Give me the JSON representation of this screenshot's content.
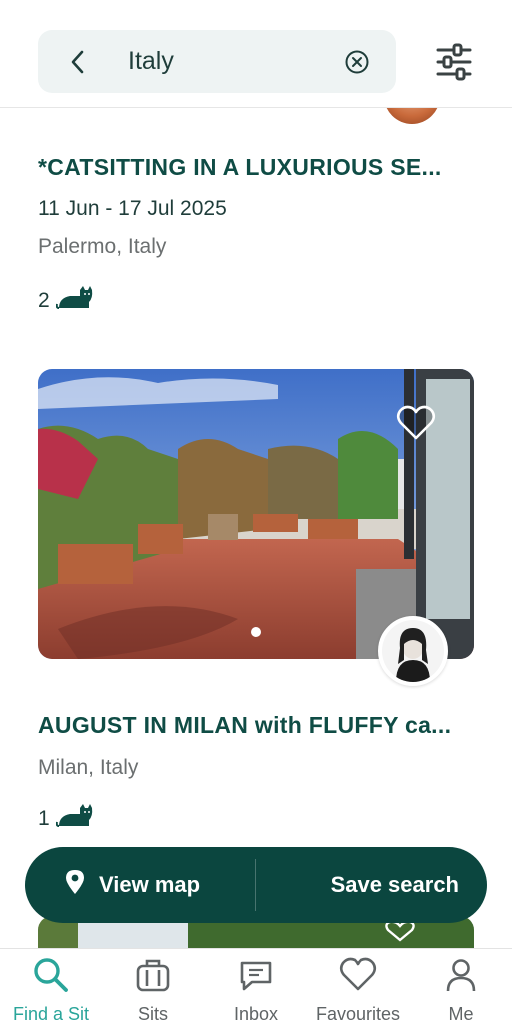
{
  "search": {
    "query": "Italy"
  },
  "listings": [
    {
      "title": "*CATSITTING IN A LUXURIOUS SE...",
      "dates": "11 Jun - 17 Jul 2025",
      "location": "Palermo, Italy",
      "pet_count": "2",
      "pet_icon": "cat-icon"
    },
    {
      "title": "AUGUST IN MILAN with FLUFFY ca...",
      "location": "Milan, Italy",
      "pet_count": "1",
      "pet_icon": "cat-icon"
    }
  ],
  "actions": {
    "view_map": "View map",
    "save_search": "Save search"
  },
  "nav": [
    {
      "label": "Find a Sit",
      "icon": "search-icon",
      "active": true
    },
    {
      "label": "Sits",
      "icon": "suitcase-icon"
    },
    {
      "label": "Inbox",
      "icon": "chat-icon"
    },
    {
      "label": "Favourites",
      "icon": "heart-icon"
    },
    {
      "label": "Me",
      "icon": "person-icon"
    }
  ],
  "colors": {
    "brand": "#0b463f",
    "accent": "#2aa59a",
    "text_primary": "#0f4c45",
    "text_muted": "#6b6f70"
  }
}
